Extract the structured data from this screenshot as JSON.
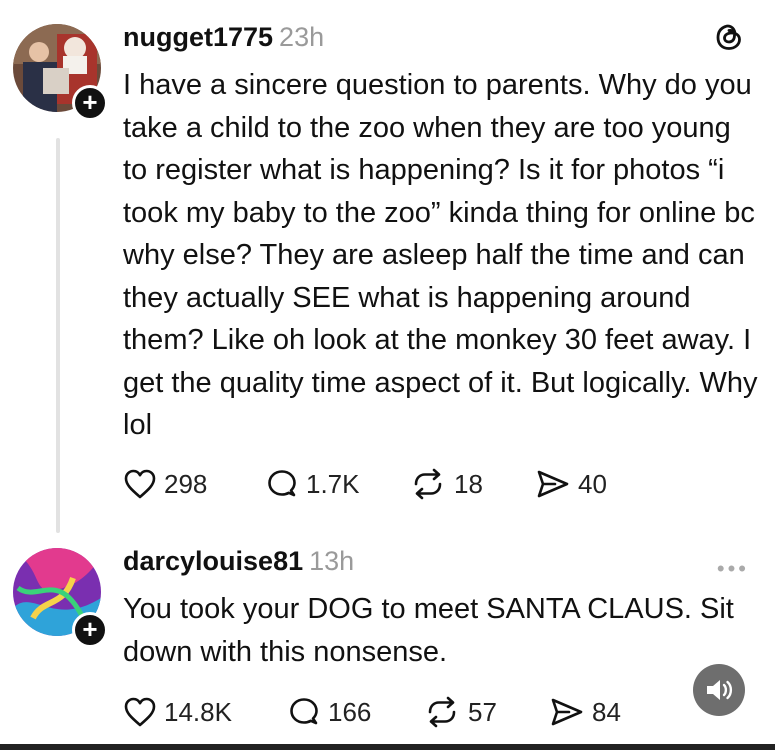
{
  "posts": [
    {
      "username": "nugget1775",
      "time": "23h",
      "text": "I have a sincere question to parents. Why do you take a child to the zoo when they are too young to register what is happening? Is it for photos “i took my baby to the zoo” kinda thing for online bc why else? They are asleep half the time and can they actually SEE what is happening around them? Like oh look at the monkey 30 feet away. I get the quality time aspect of it. But logically. Why lol",
      "likes": "298",
      "replies": "1.7K",
      "reposts": "18",
      "shares": "40"
    },
    {
      "username": "darcylouise81",
      "time": "13h",
      "text": "You took your DOG to meet SANTA CLAUS. Sit down with this nonsense.",
      "likes": "14.8K",
      "replies": "166",
      "reposts": "57",
      "shares": "84"
    }
  ],
  "icons": {
    "like": "heart-icon",
    "reply": "comment-icon",
    "repost": "repost-icon",
    "share": "send-icon",
    "brand": "threads-logo-icon",
    "more": "more-icon",
    "sound": "speaker-icon"
  },
  "colors": {
    "text": "#111111",
    "muted": "#9a9a9a",
    "thread_line": "#e2e2e2",
    "sound_button": "#6e6e6e"
  }
}
